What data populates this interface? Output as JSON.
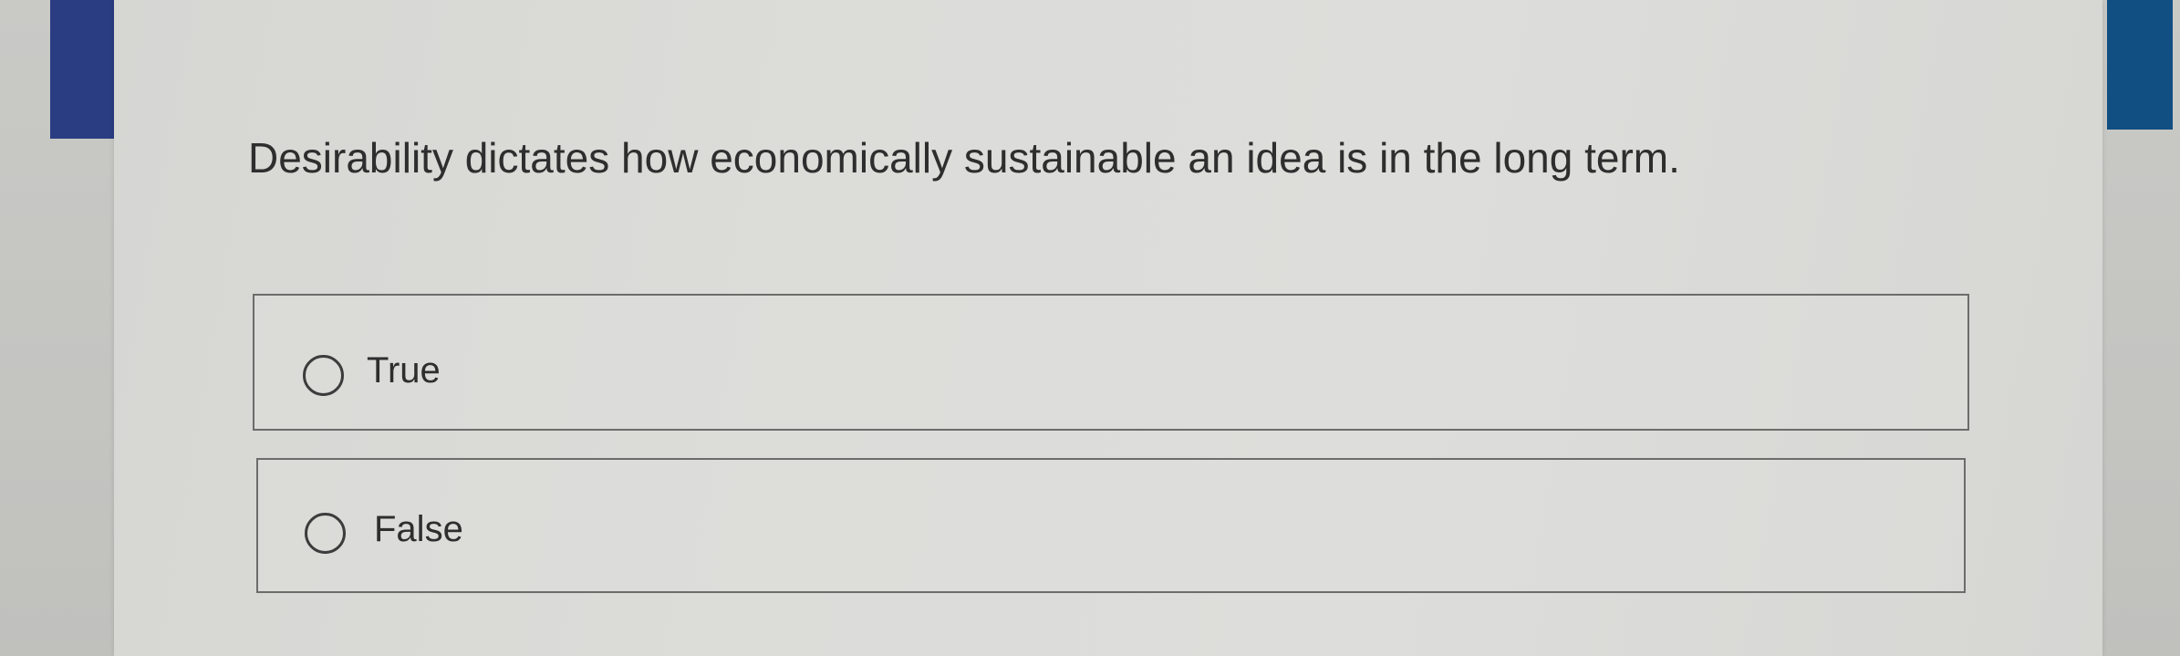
{
  "question": {
    "text": "Desirability dictates how economically sustainable an idea is in the long term."
  },
  "options": [
    {
      "label": "True",
      "selected": false
    },
    {
      "label": "False",
      "selected": false
    }
  ],
  "colors": {
    "left_band": "#2b3d82",
    "right_band": "#114e82",
    "card_background": "#dcdcd9",
    "option_border": "#6c6c6a",
    "text": "#2e2e2e"
  },
  "icons": {
    "radio": "radio-unchecked-icon"
  }
}
